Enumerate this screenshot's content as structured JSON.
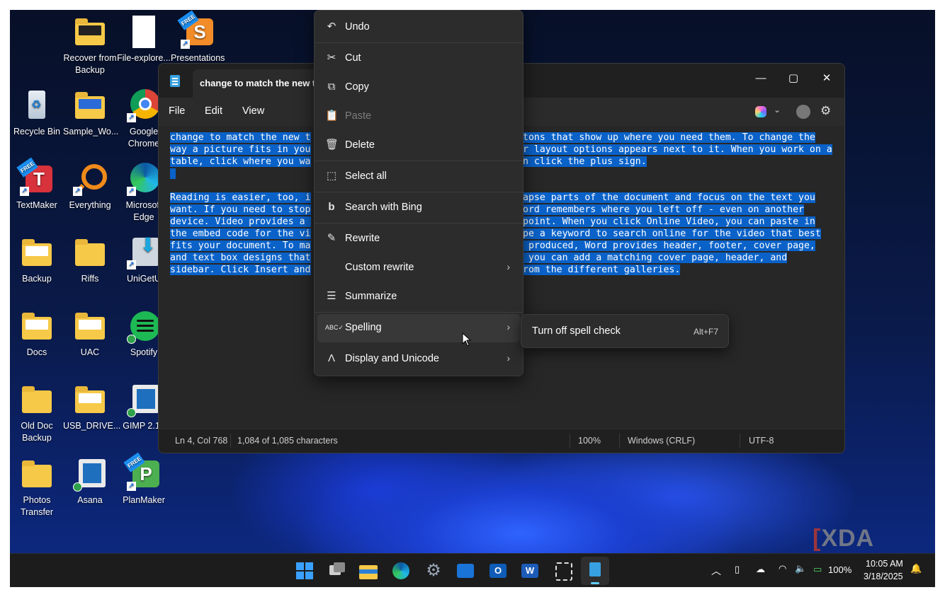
{
  "desktop": {
    "icons": [
      {
        "label": "Recover from Backup"
      },
      {
        "label": "File-explore..."
      },
      {
        "label": "Presentations"
      },
      {
        "label": "Recycle Bin"
      },
      {
        "label": "Sample_Wo..."
      },
      {
        "label": "Google Chrome"
      },
      {
        "label": "TextMaker"
      },
      {
        "label": "Everything"
      },
      {
        "label": "Microsoft Edge"
      },
      {
        "label": "Backup"
      },
      {
        "label": "Riffs"
      },
      {
        "label": "UniGetU"
      },
      {
        "label": "Docs"
      },
      {
        "label": "UAC"
      },
      {
        "label": "Spotify"
      },
      {
        "label": "Old Doc Backup"
      },
      {
        "label": "USB_DRIVE..."
      },
      {
        "label": "GIMP 2.10"
      },
      {
        "label": "Photos Transfer"
      },
      {
        "label": "Asana"
      },
      {
        "label": "PlanMaker"
      }
    ]
  },
  "notepad": {
    "tab_title": "change to match the new the",
    "menus": [
      "File",
      "Edit",
      "View"
    ],
    "editor_lines": [
      "change to match the new t",
      "way a picture fits in you",
      "table, click where you wa",
      " ",
      "Reading is easier, too, i",
      "want. If you need to stop",
      "device. Video provides a ",
      "the embed code for the vi",
      "fits your document. To ma",
      "and text box designs that",
      "sidebar. Click Insert and"
    ],
    "editor_lines_right": [
      "tons that show up where you need them. To change the",
      "r layout options appears next to it. When you work on a",
      "n click the plus sign.",
      "",
      "apse parts of the document and focus on the text you",
      "ord remembers where you left off - even on another",
      "point. When you click Online Video, you can paste in",
      "pe a keyword to search online for the video that best",
      " produced, Word provides header, footer, cover page,",
      " you can add a matching cover page, header, and",
      "rom the different galleries."
    ],
    "status": {
      "position": "Ln 4, Col 768",
      "chars": "1,084 of 1,085 characters",
      "zoom": "100%",
      "line_ending": "Windows (CRLF)",
      "encoding": "UTF-8"
    }
  },
  "context_menu": {
    "items": [
      {
        "label": "Undo",
        "icon": "undo-icon"
      },
      {
        "label": "Cut",
        "icon": "scissors-icon"
      },
      {
        "label": "Copy",
        "icon": "copy-icon"
      },
      {
        "label": "Paste",
        "icon": "paste-icon",
        "disabled": true
      },
      {
        "label": "Delete",
        "icon": "trash-icon"
      },
      {
        "label": "Select all",
        "icon": "select-all-icon"
      },
      {
        "label": "Search with Bing",
        "icon": "bing-icon"
      },
      {
        "label": "Rewrite",
        "icon": "rewrite-icon"
      },
      {
        "label": "Custom rewrite",
        "icon": ""
      },
      {
        "label": "Summarize",
        "icon": "summarize-icon"
      },
      {
        "label": "Spelling",
        "icon": "spelling-icon"
      },
      {
        "label": "Display and Unicode",
        "icon": "unicode-icon"
      }
    ],
    "submenu": {
      "label": "Turn off spell check",
      "shortcut": "Alt+F7"
    }
  },
  "taskbar": {
    "battery": "100%",
    "time": "10:05 AM",
    "date": "3/18/2025"
  },
  "watermark": "XDA"
}
